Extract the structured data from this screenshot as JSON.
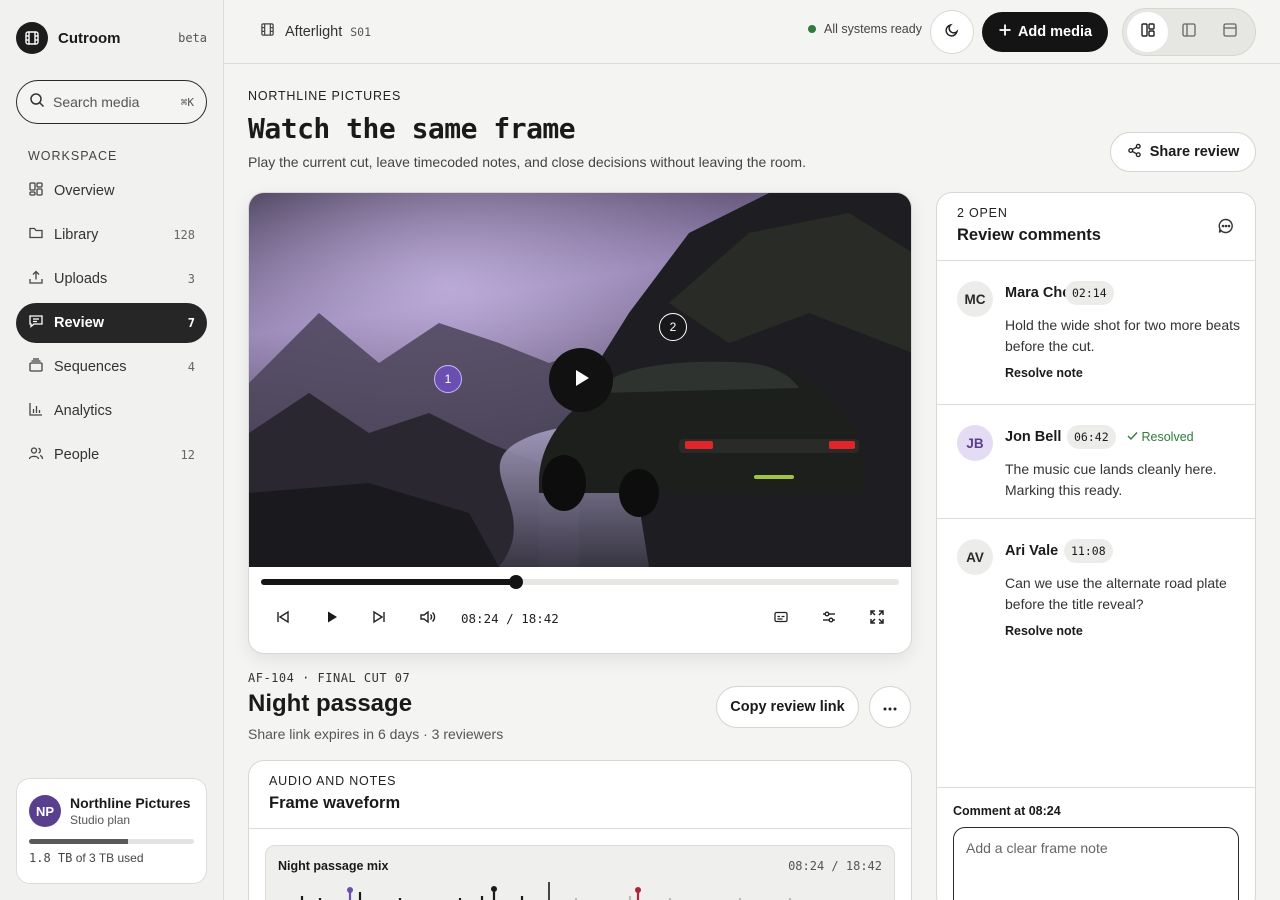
{
  "app": {
    "name": "Cutroom",
    "tag": "beta"
  },
  "search": {
    "placeholder": "Search media",
    "shortcut": "⌘K"
  },
  "sidebar": {
    "section": "WORKSPACE",
    "items": [
      {
        "label": "Overview",
        "count": "",
        "icon": "grid-icon"
      },
      {
        "label": "Library",
        "count": "128",
        "icon": "folder-icon"
      },
      {
        "label": "Uploads",
        "count": "3",
        "icon": "upload-icon"
      },
      {
        "label": "Review",
        "count": "7",
        "icon": "message-icon",
        "active": true
      },
      {
        "label": "Sequences",
        "count": "4",
        "icon": "layers-icon"
      },
      {
        "label": "Analytics",
        "count": "",
        "icon": "bar-chart-icon"
      },
      {
        "label": "People",
        "count": "12",
        "icon": "people-icon"
      }
    ]
  },
  "account": {
    "initials": "NP",
    "name": "Northline Pictures",
    "plan": "Studio plan",
    "used": "1.8 TB",
    "used_suffix": "of 3 TB used",
    "used_fraction": 0.6
  },
  "topbar": {
    "project": "Afterlight",
    "code": "S01",
    "status": "All systems ready",
    "add_label": "Add media"
  },
  "header": {
    "eyebrow": "NORTHLINE PICTURES",
    "title": "Watch the same frame",
    "subtitle": "Play the current cut, leave timecoded notes, and close decisions without leaving the room.",
    "share_label": "Share review"
  },
  "player": {
    "markers": [
      "1",
      "2"
    ],
    "current": "08:24",
    "duration": "18:42",
    "timecode": "08:24 / 18:42",
    "progress": 0.4
  },
  "media": {
    "code": "AF-104 · FINAL CUT 07",
    "title": "Night passage",
    "meta": "Share link expires in 6 days · 3 reviewers",
    "copy_label": "Copy review link"
  },
  "audio": {
    "eyebrow": "AUDIO AND NOTES",
    "title": "Frame waveform",
    "track": "Night passage mix",
    "timecode": "08:24 / 18:42"
  },
  "comments": {
    "eyebrow": "2 OPEN",
    "title": "Review comments",
    "items": [
      {
        "initials": "MC",
        "name": "Mara Chen",
        "time": "02:14",
        "resolved": "",
        "text": "Hold the wide shot for two more beats before the cut.",
        "action": "Resolve note"
      },
      {
        "initials": "JB",
        "name": "Jon Bell",
        "time": "06:42",
        "resolved": "Resolved",
        "text": "The music cue lands cleanly here. Marking this ready.",
        "action": ""
      },
      {
        "initials": "AV",
        "name": "Ari Vale",
        "time": "11:08",
        "resolved": "",
        "text": "Can we use the alternate road plate before the title reveal?",
        "action": "Resolve note"
      }
    ],
    "compose_label": "Comment at 08:24",
    "compose_placeholder": "Add a clear frame note"
  },
  "colors": {
    "accent": "#6a4fb0",
    "status_ok": "#2f7a3d",
    "dark": "#141414"
  }
}
